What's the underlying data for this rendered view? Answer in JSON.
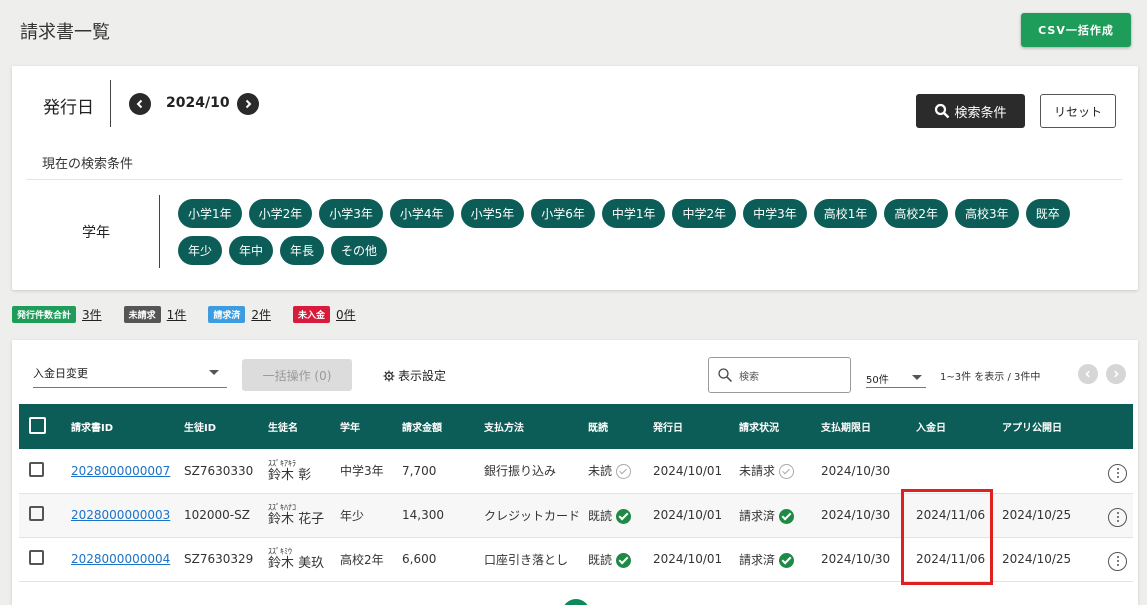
{
  "page": {
    "title": "請求書一覧",
    "csv_label": "CSV一括作成"
  },
  "filter": {
    "issue_label": "発行日",
    "month": "2024/10",
    "search_label": "検索条件",
    "reset_label": "リセット",
    "current_label": "現在の検索条件",
    "grade_label": "学年",
    "chips": [
      "小学1年",
      "小学2年",
      "小学3年",
      "小学4年",
      "小学5年",
      "小学6年",
      "中学1年",
      "中学2年",
      "中学3年",
      "高校1年",
      "高校2年",
      "高校3年",
      "既卒",
      "年少",
      "年中",
      "年長",
      "その他"
    ]
  },
  "summary": [
    {
      "tag": "発行件数合計",
      "count": "3件",
      "color": "#1e9c5a"
    },
    {
      "tag": "未請求",
      "count": "1件",
      "color": "#555555"
    },
    {
      "tag": "請求済",
      "count": "2件",
      "color": "#3d9be0"
    },
    {
      "tag": "未入金",
      "count": "0件",
      "color": "#d81b3c"
    }
  ],
  "toolbar": {
    "select_value": "入金日変更",
    "bulk_label": "一括操作 (0)",
    "display_label": "表示設定",
    "search_placeholder": "検索",
    "per_page": "50件",
    "range_text": "1~3件 を表示 / 3件中"
  },
  "table": {
    "headers": [
      "請求書ID",
      "生徒ID",
      "生徒名",
      "学年",
      "請求金額",
      "支払方法",
      "既読",
      "発行日",
      "請求状況",
      "支払期限日",
      "入金日",
      "アプリ公開日"
    ],
    "rows": [
      {
        "invoice_id": "2028000000007",
        "student_id": "SZ7630330",
        "furigana": "ｽｽﾞｷｱｷﾗ",
        "name": "鈴木 彰",
        "grade": "中学3年",
        "amount": "7,700",
        "method": "銀行振り込み",
        "read": "未読",
        "read_ok": false,
        "issued": "2024/10/01",
        "status": "未請求",
        "status_ok": false,
        "due": "2024/10/30",
        "paid": "",
        "published": ""
      },
      {
        "invoice_id": "2028000000003",
        "student_id": "102000-SZ",
        "furigana": "ｽｽﾞｷﾊﾅｺ",
        "name": "鈴木 花子",
        "grade": "年少",
        "amount": "14,300",
        "method": "クレジットカード",
        "read": "既読",
        "read_ok": true,
        "issued": "2024/10/01",
        "status": "請求済",
        "status_ok": true,
        "due": "2024/10/30",
        "paid": "2024/11/06",
        "published": "2024/10/25"
      },
      {
        "invoice_id": "2028000000004",
        "student_id": "SZ7630329",
        "furigana": "ｽｽﾞｷﾐｳ",
        "name": "鈴木 美玖",
        "grade": "高校2年",
        "amount": "6,600",
        "method": "口座引き落とし",
        "read": "既読",
        "read_ok": true,
        "issued": "2024/10/01",
        "status": "請求済",
        "status_ok": true,
        "due": "2024/10/30",
        "paid": "2024/11/06",
        "published": "2024/10/25"
      }
    ]
  }
}
